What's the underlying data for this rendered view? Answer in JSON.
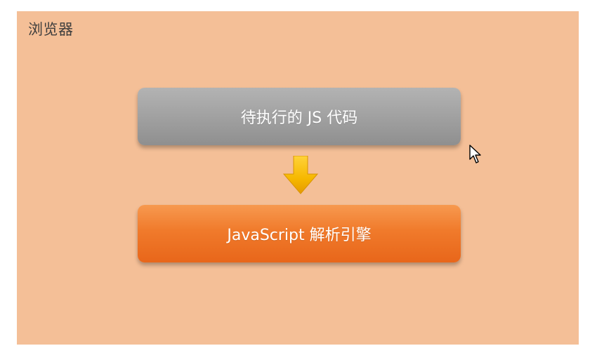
{
  "slide": {
    "title": "浏览器"
  },
  "diagram": {
    "source_box_label": "待执行的 JS 代码",
    "engine_box_label": "JavaScript 解析引擎",
    "arrow_icon": "down-arrow-icon",
    "cursor_icon": "mouse-cursor-icon"
  },
  "colors": {
    "background": "#f4bf97",
    "source_box": "#a3a3a3",
    "engine_box": "#f07a2b",
    "arrow": "#f6b800"
  }
}
